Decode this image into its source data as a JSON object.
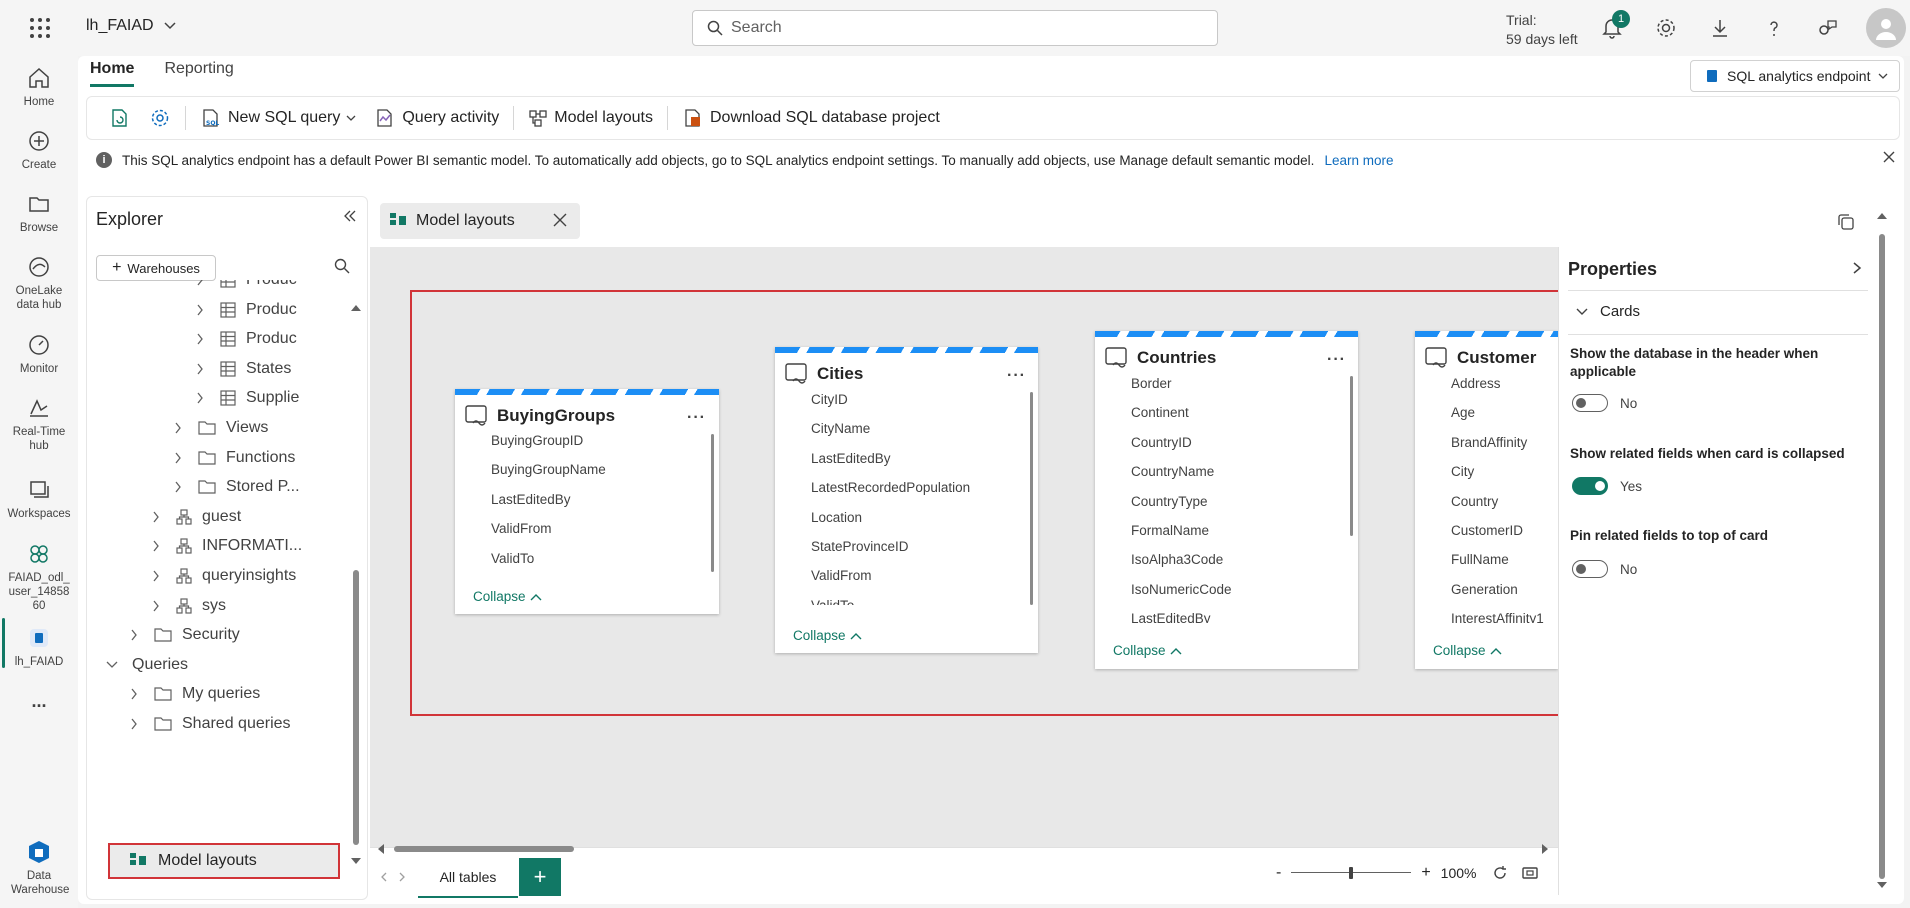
{
  "topbar": {
    "workspace_name": "lh_FAIAD",
    "search_placeholder": "Search",
    "trial_line1": "Trial:",
    "trial_line2": "59 days left",
    "notification_count": "1"
  },
  "rail": {
    "items": [
      {
        "label": "Home",
        "icon": "home-icon"
      },
      {
        "label": "Create",
        "icon": "plus-circle-icon"
      },
      {
        "label": "Browse",
        "icon": "folder-icon"
      },
      {
        "label": "OneLake data hub",
        "icon": "onelake-icon"
      },
      {
        "label": "Monitor",
        "icon": "monitor-icon"
      },
      {
        "label": "Real-Time hub",
        "icon": "realtime-icon"
      },
      {
        "label": "Workspaces",
        "icon": "workspaces-icon"
      },
      {
        "label": "FAIAD_odl_user_1485860",
        "icon": "workspace-icon"
      },
      {
        "label": "lh_FAIAD",
        "icon": "sql-endpoint-icon"
      },
      {
        "label": "...",
        "icon": "more-icon"
      },
      {
        "label": "Data Warehouse",
        "icon": "data-warehouse-icon"
      }
    ]
  },
  "header": {
    "tabs": [
      "Home",
      "Reporting"
    ],
    "endpoint_selector": "SQL analytics endpoint"
  },
  "toolbar": {
    "new_sql_query": "New SQL query",
    "query_activity": "Query activity",
    "model_layouts": "Model layouts",
    "download_project": "Download SQL database project"
  },
  "infobar": {
    "message": "This SQL analytics endpoint has a default Power BI semantic model. To automatically add objects, go to SQL analytics endpoint settings. To manually add objects, use Manage default semantic model.",
    "link": "Learn more"
  },
  "explorer": {
    "title": "Explorer",
    "warehouses_button": "Warehouses",
    "tree": [
      {
        "label": "Produc",
        "indent": 4,
        "type": "table"
      },
      {
        "label": "Produc",
        "indent": 4,
        "type": "table"
      },
      {
        "label": "Produc",
        "indent": 4,
        "type": "table"
      },
      {
        "label": "States",
        "indent": 4,
        "type": "table"
      },
      {
        "label": "Supplie",
        "indent": 4,
        "type": "table"
      },
      {
        "label": "Views",
        "indent": 3,
        "type": "folder"
      },
      {
        "label": "Functions",
        "indent": 3,
        "type": "folder"
      },
      {
        "label": "Stored P...",
        "indent": 3,
        "type": "folder"
      },
      {
        "label": "guest",
        "indent": 2,
        "type": "schema"
      },
      {
        "label": "INFORMATI...",
        "indent": 2,
        "type": "schema"
      },
      {
        "label": "queryinsights",
        "indent": 2,
        "type": "schema"
      },
      {
        "label": "sys",
        "indent": 2,
        "type": "schema"
      },
      {
        "label": "Security",
        "indent": 1,
        "type": "folder"
      },
      {
        "label": "Queries",
        "indent": 0,
        "type": "section"
      },
      {
        "label": "My queries",
        "indent": 1,
        "type": "folder"
      },
      {
        "label": "Shared queries",
        "indent": 1,
        "type": "folder"
      }
    ],
    "model_layouts_item": "Model layouts"
  },
  "document_tab": {
    "label": "Model layouts"
  },
  "cards": [
    {
      "name": "BuyingGroups",
      "fields": [
        "BuyingGroupID",
        "BuyingGroupName",
        "LastEditedBy",
        "ValidFrom",
        "ValidTo"
      ],
      "collapse": "Collapse"
    },
    {
      "name": "Cities",
      "fields": [
        "CityID",
        "CityName",
        "LastEditedBy",
        "LatestRecordedPopulation",
        "Location",
        "StateProvinceID",
        "ValidFrom",
        "ValidTo"
      ],
      "collapse": "Collapse"
    },
    {
      "name": "Countries",
      "fields": [
        "Border",
        "Continent",
        "CountryID",
        "CountryName",
        "CountryType",
        "FormalName",
        "IsoAlpha3Code",
        "IsoNumericCode",
        "LastEditedBy"
      ],
      "collapse": "Collapse"
    },
    {
      "name": "Customer",
      "fields": [
        "Address",
        "Age",
        "BrandAffinity",
        "City",
        "Country",
        "CustomerID",
        "FullName",
        "Generation",
        "InterestAffinity1"
      ],
      "collapse": "Collapse"
    }
  ],
  "properties": {
    "title": "Properties",
    "section": "Cards",
    "settings": [
      {
        "label": "Show the database in the header when applicable",
        "value": "No",
        "on": false
      },
      {
        "label": "Show related fields when card is collapsed",
        "value": "Yes",
        "on": true
      },
      {
        "label": "Pin related fields to top of card",
        "value": "No",
        "on": false
      }
    ]
  },
  "bottom": {
    "all_tables_tab": "All tables",
    "add_tab": "+",
    "zoom_minus": "-",
    "zoom_plus": "+",
    "zoom_level": "100%",
    "zoom_fraction": 0.5
  },
  "colors": {
    "accent": "#117865",
    "highlight": "#d13438",
    "stripe": "#1c8ef5",
    "link": "#0f6cbd"
  }
}
